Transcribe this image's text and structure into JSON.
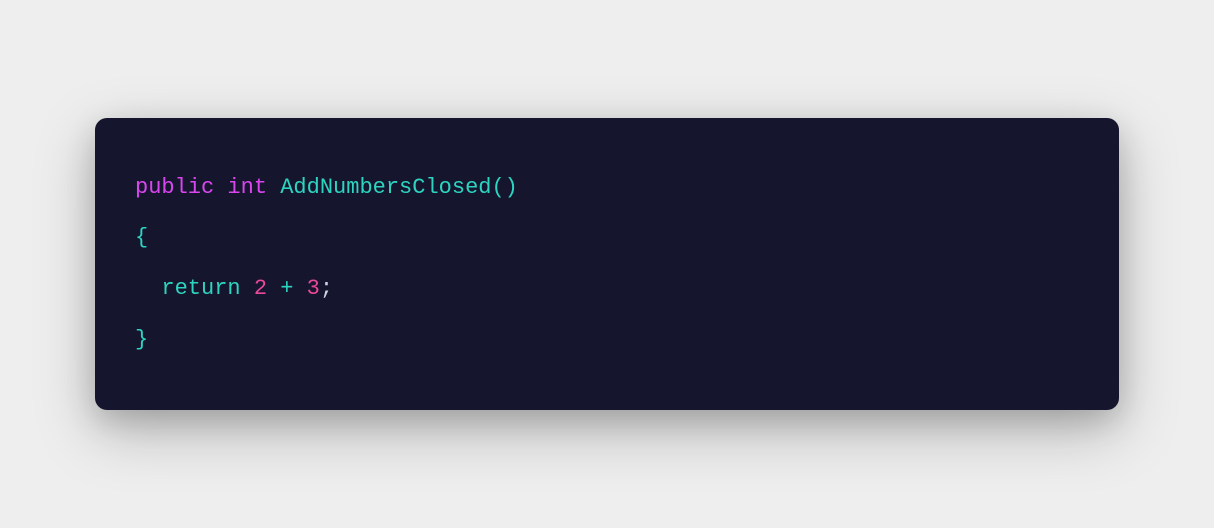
{
  "code": {
    "line1": {
      "keyword_public": "public",
      "space1": " ",
      "keyword_int": "int",
      "space2": " ",
      "function_name": "AddNumbersClosed",
      "paren_open": "(",
      "paren_close": ")"
    },
    "line2": {
      "brace_open": "{"
    },
    "line3": {
      "indent": "  ",
      "keyword_return": "return",
      "space1": " ",
      "number1": "2",
      "space2": " ",
      "operator": "+",
      "space3": " ",
      "number2": "3",
      "semicolon": ";"
    },
    "line4": {
      "brace_close": "}"
    }
  }
}
